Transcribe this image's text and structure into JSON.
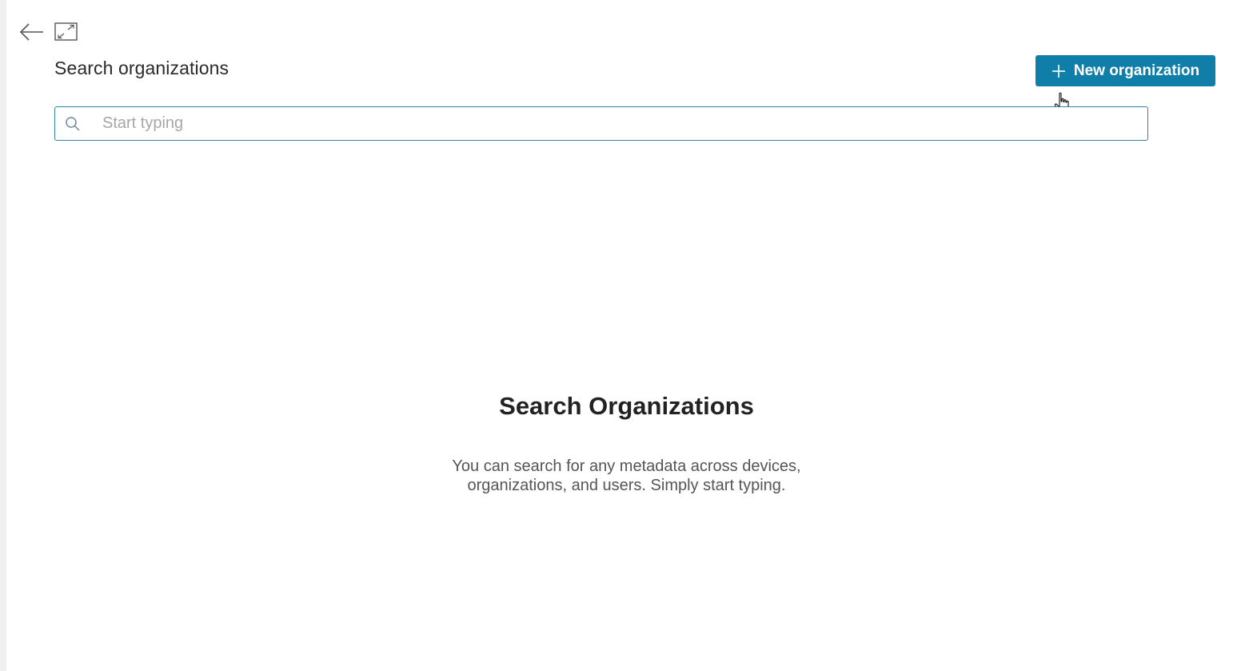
{
  "header": {
    "title": "Search organizations",
    "back_icon": "arrow-left-icon",
    "expand_icon": "expand-icon"
  },
  "actions": {
    "new_organization_label": "New organization",
    "new_organization_icon": "plus-icon",
    "accent_color": "#0f7ea9"
  },
  "search": {
    "placeholder": "Start typing",
    "value": "",
    "icon": "search-icon"
  },
  "empty_state": {
    "title": "Search Organizations",
    "description_line1": "You can search for any metadata across devices,",
    "description_line2": "organizations, and users. Simply start typing."
  }
}
